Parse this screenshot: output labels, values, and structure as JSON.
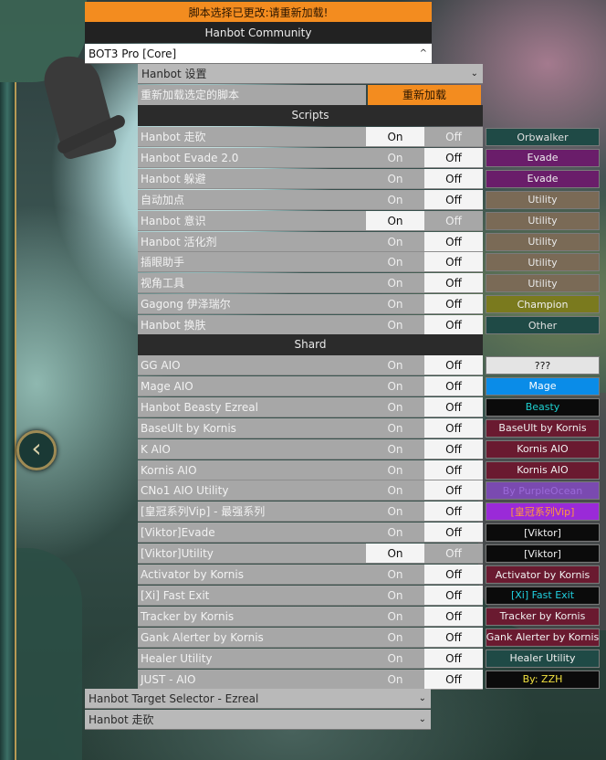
{
  "banner": {
    "text": "脚本选择已更改:请重新加载!"
  },
  "community": {
    "title": "Hanbot Community"
  },
  "core_select": {
    "value": "BOT3 Pro [Core]",
    "icon": "chevron-up-icon"
  },
  "settings_select": {
    "value": "Hanbot 设置",
    "icon": "chevron-down-icon"
  },
  "reload": {
    "label": "重新加载选定的脚本",
    "button": "重新加载"
  },
  "toggle": {
    "on": "On",
    "off": "Off"
  },
  "sections": {
    "scripts": "Scripts",
    "shard": "Shard"
  },
  "scripts": [
    {
      "name": "Hanbot 走砍",
      "state": "on",
      "tag": "Orbwalker",
      "tag_bg": "#1f4a46",
      "tag_fg": "#e0e0e0"
    },
    {
      "name": "Hanbot Evade 2.0",
      "state": "off",
      "tag": "Evade",
      "tag_bg": "#6a1d6a",
      "tag_fg": "#f0f0f0"
    },
    {
      "name": "Hanbot 躲避",
      "state": "off",
      "tag": "Evade",
      "tag_bg": "#6a1d6a",
      "tag_fg": "#f0f0f0"
    },
    {
      "name": "自动加点",
      "state": "off",
      "tag": "Utility",
      "tag_bg": "#7a6a56",
      "tag_fg": "#e8e8e8"
    },
    {
      "name": "Hanbot 意识",
      "state": "on",
      "tag": "Utility",
      "tag_bg": "#7a6a56",
      "tag_fg": "#e8e8e8"
    },
    {
      "name": "Hanbot 活化剂",
      "state": "off",
      "tag": "Utility",
      "tag_bg": "#7a6a56",
      "tag_fg": "#e8e8e8"
    },
    {
      "name": "插眼助手",
      "state": "off",
      "tag": "Utility",
      "tag_bg": "#7a6a56",
      "tag_fg": "#e8e8e8"
    },
    {
      "name": "视角工具",
      "state": "off",
      "tag": "Utility",
      "tag_bg": "#7a6a56",
      "tag_fg": "#e8e8e8"
    },
    {
      "name": "Gagong 伊泽瑞尔",
      "state": "off",
      "tag": "Champion",
      "tag_bg": "#7a7a1e",
      "tag_fg": "#f0f0f0"
    },
    {
      "name": "Hanbot 换肤",
      "state": "off",
      "tag": "Other",
      "tag_bg": "#1f4a46",
      "tag_fg": "#e0e0e0"
    }
  ],
  "shard": [
    {
      "name": "GG AIO",
      "state": "off",
      "tag": "???",
      "tag_bg": "#e4e4e4",
      "tag_fg": "#111111"
    },
    {
      "name": "Mage AIO",
      "state": "off",
      "tag": "Mage",
      "tag_bg": "#0a8ce8",
      "tag_fg": "#ffffff"
    },
    {
      "name": "Hanbot Beasty Ezreal",
      "state": "off",
      "tag": "Beasty",
      "tag_bg": "#0b0b0b",
      "tag_fg": "#1ed0d0"
    },
    {
      "name": "BaseUlt by Kornis",
      "state": "off",
      "tag": "BaseUlt by Kornis",
      "tag_bg": "#6a1a30",
      "tag_fg": "#f0f0f0"
    },
    {
      "name": "K AIO",
      "state": "off",
      "tag": "Kornis AIO",
      "tag_bg": "#6a1a30",
      "tag_fg": "#f0f0f0"
    },
    {
      "name": "Kornis AIO",
      "state": "off",
      "tag": "Kornis AIO",
      "tag_bg": "#6a1a30",
      "tag_fg": "#f0f0f0"
    },
    {
      "name": "CNo1 AIO Utility",
      "state": "off",
      "tag": "By PurpleOcean",
      "tag_bg": "#7a4ab0",
      "tag_fg": "#9a6ad8"
    },
    {
      "name": "[皇冠系列Vip] - 最强系列",
      "state": "off",
      "tag": "[皇冠系列Vip]",
      "tag_bg": "#9a2ad8",
      "tag_fg": "#ff9a3a"
    },
    {
      "name": "[Viktor]Evade",
      "state": "off",
      "tag": "[Viktor]",
      "tag_bg": "#0b0b0b",
      "tag_fg": "#f0f0f0"
    },
    {
      "name": "[Viktor]Utility",
      "state": "on",
      "tag": "[Viktor]",
      "tag_bg": "#0b0b0b",
      "tag_fg": "#f0f0f0"
    },
    {
      "name": "Activator by Kornis",
      "state": "off",
      "tag": "Activator by Kornis",
      "tag_bg": "#6a1a30",
      "tag_fg": "#f0f0f0"
    },
    {
      "name": "[Xi] Fast Exit",
      "state": "off",
      "tag": "[Xi] Fast Exit",
      "tag_bg": "#0b0b0b",
      "tag_fg": "#20d0e0"
    },
    {
      "name": "Tracker by Kornis",
      "state": "off",
      "tag": "Tracker by Kornis",
      "tag_bg": "#6a1a30",
      "tag_fg": "#f0f0f0"
    },
    {
      "name": "Gank Alerter by Kornis",
      "state": "off",
      "tag": "Gank Alerter by Kornis",
      "tag_bg": "#6a1a30",
      "tag_fg": "#f0f0f0"
    },
    {
      "name": "Healer Utility",
      "state": "off",
      "tag": "Healer Utility",
      "tag_bg": "#1f4a46",
      "tag_fg": "#f0f0f0"
    },
    {
      "name": "JUST - AIO",
      "state": "off",
      "tag": "By: ZZH",
      "tag_bg": "#0b0b0b",
      "tag_fg": "#f0e040"
    }
  ],
  "bottom_selects": [
    {
      "value": "Hanbot Target Selector - Ezreal",
      "icon": "chevron-down-icon"
    },
    {
      "value": "Hanbot 走砍",
      "icon": "chevron-down-icon"
    }
  ],
  "back_button": {
    "icon": "chevron-left-icon"
  }
}
